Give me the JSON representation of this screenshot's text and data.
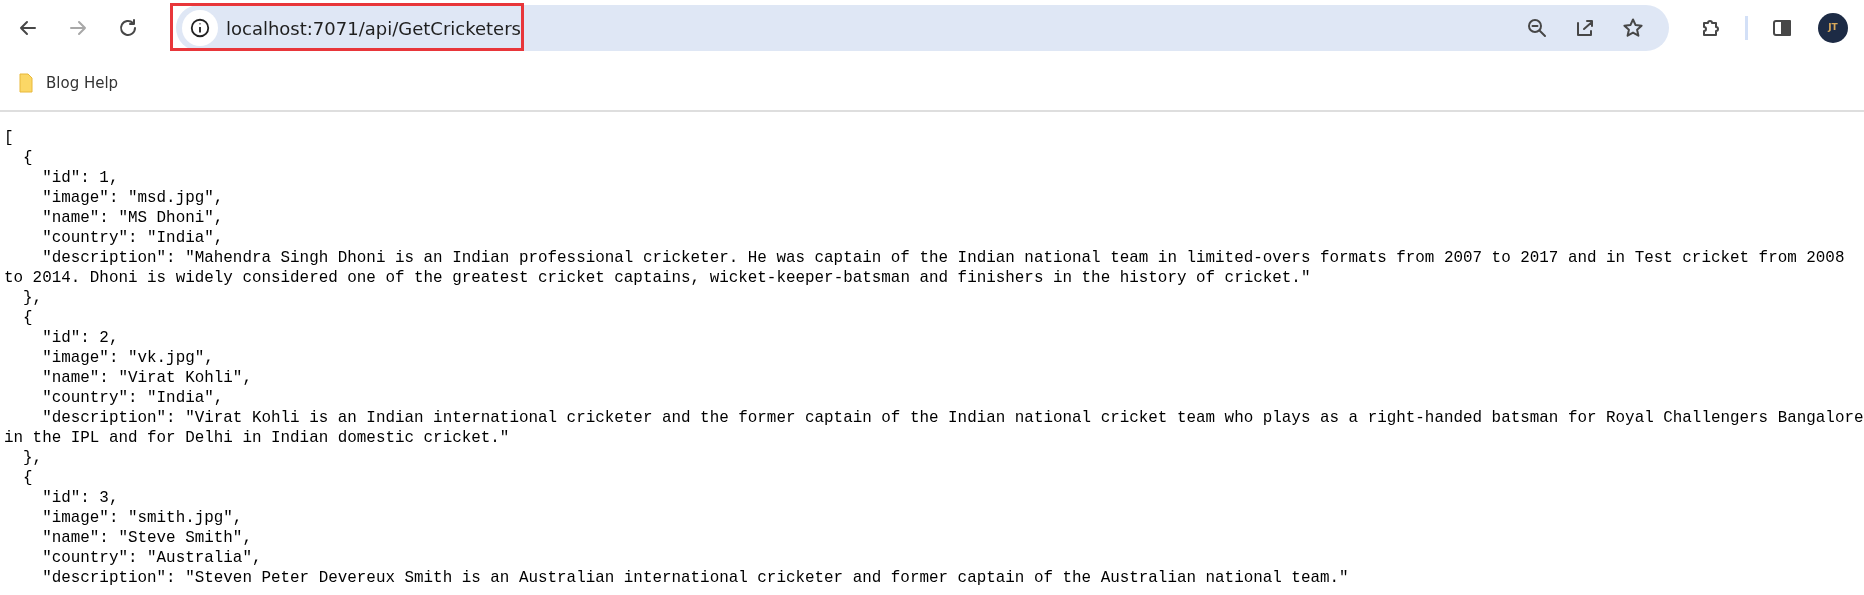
{
  "browser": {
    "nav_buttons": [
      {
        "kind": "back",
        "disabled": false
      },
      {
        "kind": "forward",
        "disabled": true
      },
      {
        "kind": "reload",
        "disabled": false
      }
    ],
    "address_bar": {
      "url": "localhost:7071/api/GetCricketers",
      "highlighted": true,
      "actions": [
        {
          "kind": "zoom-out"
        },
        {
          "kind": "share"
        },
        {
          "kind": "star"
        }
      ]
    },
    "toolbar_icons": [
      {
        "kind": "extensions"
      },
      {
        "kind": "side-panel"
      }
    ],
    "profile": {
      "initials": "JT"
    },
    "bookmarks": [
      {
        "label": "Blog Help"
      }
    ]
  },
  "json_view": {
    "open": "[",
    "items": [
      {
        "open": "{",
        "fields": [
          "\"id\": 1,",
          "\"image\": \"msd.jpg\",",
          "\"name\": \"MS Dhoni\",",
          "\"country\": \"India\","
        ],
        "description": "\"description\": \"Mahendra Singh Dhoni is an Indian professional cricketer. He was captain of the Indian national team in limited-overs formats from 2007 to 2017 and in Test cricket from 2008 to 2014. Dhoni is widely considered one of the greatest cricket captains, wicket-keeper-batsman and finishers in the history of cricket.\"",
        "close": "},"
      },
      {
        "open": "{",
        "fields": [
          "\"id\": 2,",
          "\"image\": \"vk.jpg\",",
          "\"name\": \"Virat Kohli\",",
          "\"country\": \"India\","
        ],
        "description": "\"description\": \"Virat Kohli is an Indian international cricketer and the former captain of the Indian national cricket team who plays as a right-handed batsman for Royal Challengers Bangalore in the IPL and for Delhi in Indian domestic cricket.\"",
        "close": "},"
      },
      {
        "open": "{",
        "fields": [
          "\"id\": 3,",
          "\"image\": \"smith.jpg\",",
          "\"name\": \"Steve Smith\",",
          "\"country\": \"Australia\","
        ],
        "description": "\"description\": \"Steven Peter Devereux Smith is an Australian international cricketer and former captain of the Australian national team.\""
      }
    ]
  }
}
